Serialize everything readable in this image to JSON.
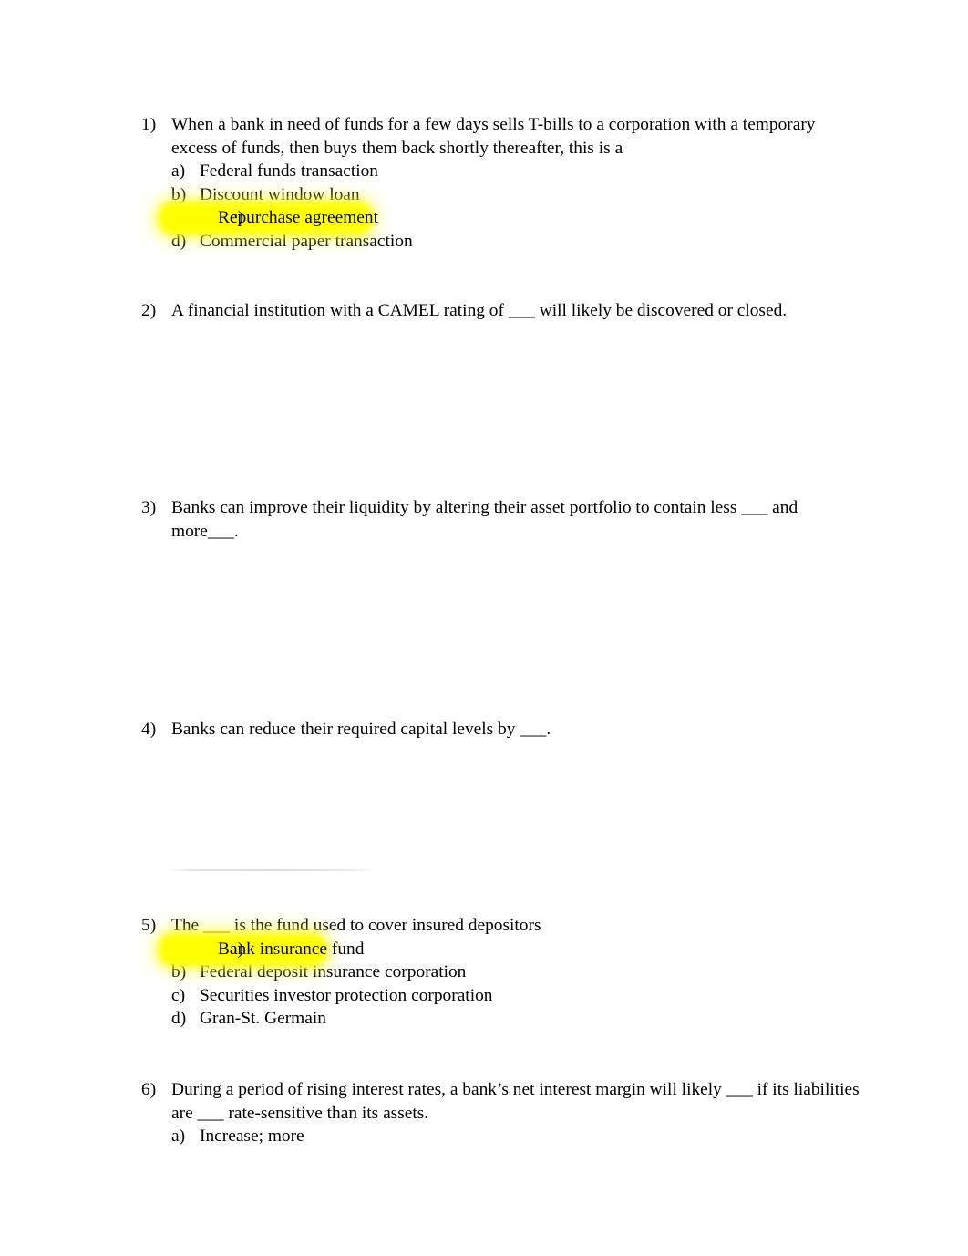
{
  "document": {
    "page_background": "#ffffff",
    "text_color": "#000000",
    "highlight_color": "#ffff00",
    "questions": [
      {
        "number": "1)",
        "stem_lines": [
          "When a bank in need of funds for a few days sells T-bills to a corporation with a temporary",
          "excess of funds, then buys them back shortly thereafter, this is a"
        ],
        "options": [
          {
            "marker": "a)",
            "text": "Federal funds transaction",
            "highlighted": false
          },
          {
            "marker": "b)",
            "text": "Discount window loan",
            "highlighted": false
          },
          {
            "marker": "c)",
            "text": "Repurchase agreement",
            "highlighted": true
          },
          {
            "marker": "d)",
            "text": "Commercial paper transaction",
            "highlighted": false
          }
        ]
      },
      {
        "number": "2)",
        "stem_lines": [
          "A financial institution with a CAMEL rating of ___ will likely be discovered or closed."
        ],
        "options": []
      },
      {
        "number": "3)",
        "stem_lines": [
          "Banks can improve their liquidity by altering their asset portfolio to contain less ___ and",
          "more___."
        ],
        "options": []
      },
      {
        "number": "4)",
        "stem_lines": [
          "Banks can reduce their required capital levels by ___."
        ],
        "options": []
      },
      {
        "number": "5)",
        "stem_lines": [
          "The ___ is the fund used to cover insured depositors"
        ],
        "options": [
          {
            "marker": "a)",
            "text": "Bank insurance fund",
            "highlighted": true
          },
          {
            "marker": "b)",
            "text": "Federal deposit insurance corporation",
            "highlighted": false
          },
          {
            "marker": "c)",
            "text": "Securities investor protection corporation",
            "highlighted": false
          },
          {
            "marker": "d)",
            "text": "Gran-St. Germain",
            "highlighted": false
          }
        ]
      },
      {
        "number": "6)",
        "stem_lines": [
          "During a period of rising interest rates, a bank’s net interest margin will likely ___ if its liabilities",
          "are ___ rate-sensitive than its assets."
        ],
        "options": [
          {
            "marker": "a)",
            "text": "Increase; more",
            "highlighted": false
          }
        ]
      }
    ]
  }
}
